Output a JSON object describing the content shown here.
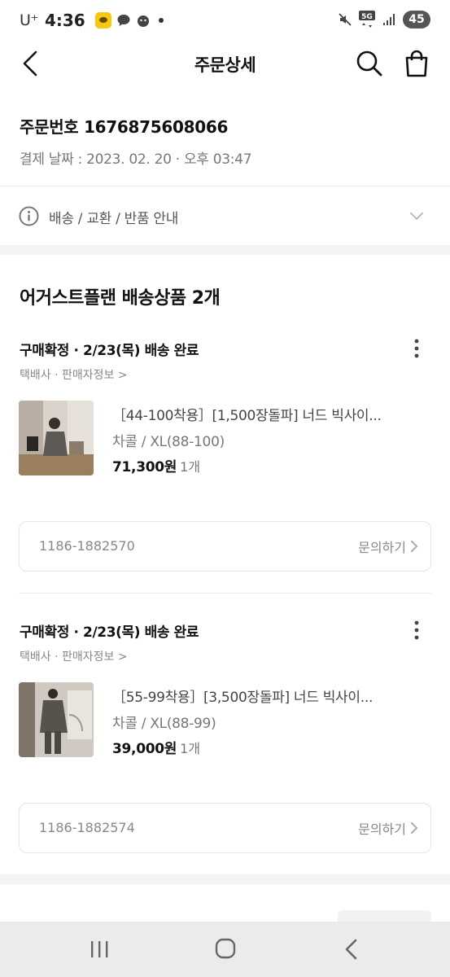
{
  "status_bar": {
    "carrier": "U⁺",
    "time": "4:36",
    "network": "5G",
    "battery": "45"
  },
  "header": {
    "title": "주문상세",
    "icons": [
      "back-arrow-icon",
      "search-icon",
      "shopping-bag-icon"
    ]
  },
  "order": {
    "number_label": "주문번호 1676875608066",
    "date_label": "결제 날짜 : 2023. 02. 20 · 오후 03:47"
  },
  "guide": {
    "text": "배송 / 교환 / 반품 안내"
  },
  "section": {
    "title": "어거스트플랜 배송상품 2개"
  },
  "items": [
    {
      "status": "구매확정 · 2/23(목) 배송 완료",
      "courier_link": "택배사 · 판매자정보 >",
      "name": "［44-100착용］[1,500장돌파] 너드 빅사이...",
      "option": "차콜 / XL(88-100)",
      "price": "71,300원",
      "qty": "1개",
      "tracking_no": "1186-1882570",
      "inquiry_label": "문의하기"
    },
    {
      "status": "구매확정 · 2/23(목) 배송 완료",
      "courier_link": "택배사 · 판매자정보 >",
      "name": "［55-99착용］[3,500장돌파] 너드 빅사이...",
      "option": "차콜 / XL(88-99)",
      "price": "39,000원",
      "qty": "1개",
      "tracking_no": "1186-1882574",
      "inquiry_label": "문의하기"
    }
  ],
  "colors": {
    "accent_red": "#e53935",
    "divider": "#f4f4f4",
    "text_muted": "#888888"
  }
}
